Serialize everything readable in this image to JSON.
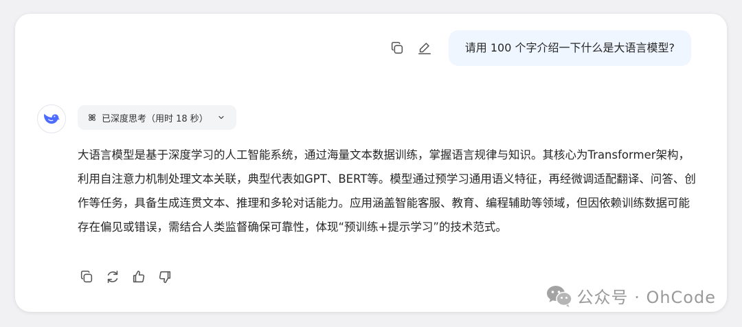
{
  "user_message": {
    "text": "请用 100 个字介绍一下什么是大语言模型?",
    "actions": [
      "copy-icon",
      "edit-icon"
    ]
  },
  "assistant": {
    "avatar_icon": "deepseek-whale-icon",
    "thinking_label": "已深度思考（用时 18 秒）",
    "paragraphs": [
      "大语言模型是基于深度学习的人工智能系统，通过海量文本数据训练，掌握语言规律与知识。其核心为Transformer架构，利用自注意力机制处理文本关联，典型代表如GPT、BERT等。模型通过预学习通用语义特征，再经微调适配翻译、问答、创作等任务，具备生成连贯文本、推理和多轮对话能力。应用涵盖智能客服、教育、编程辅助等领域，但因依赖训练数据可能存在偏见或错误，需结合人类监督确保可靠性，体现“预训练+提示学习”的技术范式。"
    ],
    "actions": [
      "copy-icon",
      "regenerate-icon",
      "thumbs-up-icon",
      "thumbs-down-icon"
    ]
  },
  "watermark": {
    "text": "公众号 · OhCode"
  },
  "colors": {
    "bubble_bg": "#eff6ff",
    "accent": "#4d6bfe",
    "icon": "#555555"
  }
}
